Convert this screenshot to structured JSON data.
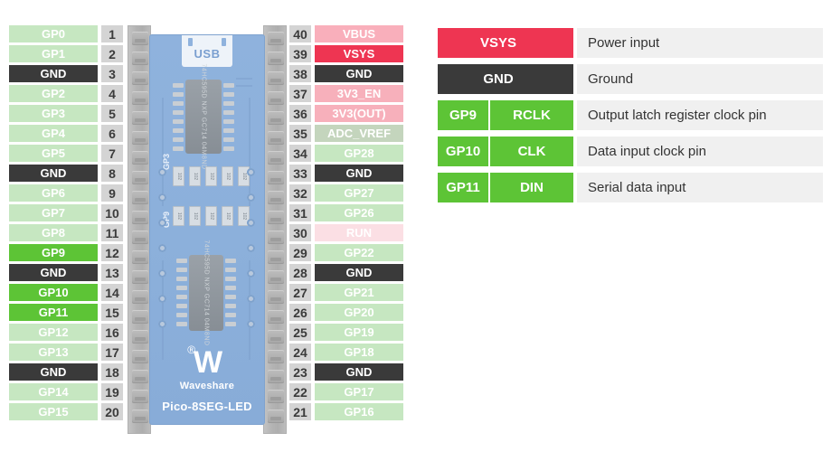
{
  "board": {
    "usb_label": "USB",
    "brand": "Waveshare",
    "brand_mark": "W",
    "registered_mark": "®",
    "model": "Pico-8SEG-LED",
    "silk_labels": [
      "GP3",
      "GP9"
    ],
    "ic_top_text": "74HC595D NXP GC714 04M8ND",
    "ic_bottom_text": "74HC595D NXP GC714 04M8ND"
  },
  "left_column": [
    {
      "num": "1",
      "label": "GP0",
      "type": "gpio"
    },
    {
      "num": "2",
      "label": "GP1",
      "type": "gpio"
    },
    {
      "num": "3",
      "label": "GND",
      "type": "gnd"
    },
    {
      "num": "4",
      "label": "GP2",
      "type": "gpio"
    },
    {
      "num": "5",
      "label": "GP3",
      "type": "gpio"
    },
    {
      "num": "6",
      "label": "GP4",
      "type": "gpio"
    },
    {
      "num": "7",
      "label": "GP5",
      "type": "gpio"
    },
    {
      "num": "8",
      "label": "GND",
      "type": "gnd"
    },
    {
      "num": "9",
      "label": "GP6",
      "type": "gpio"
    },
    {
      "num": "10",
      "label": "GP7",
      "type": "gpio"
    },
    {
      "num": "11",
      "label": "GP8",
      "type": "gpio"
    },
    {
      "num": "12",
      "label": "GP9",
      "type": "gpio-highlight"
    },
    {
      "num": "13",
      "label": "GND",
      "type": "gnd"
    },
    {
      "num": "14",
      "label": "GP10",
      "type": "gpio-highlight"
    },
    {
      "num": "15",
      "label": "GP11",
      "type": "gpio-highlight"
    },
    {
      "num": "16",
      "label": "GP12",
      "type": "gpio"
    },
    {
      "num": "17",
      "label": "GP13",
      "type": "gpio"
    },
    {
      "num": "18",
      "label": "GND",
      "type": "gnd"
    },
    {
      "num": "19",
      "label": "GP14",
      "type": "gpio"
    },
    {
      "num": "20",
      "label": "GP15",
      "type": "gpio"
    }
  ],
  "right_column": [
    {
      "num": "40",
      "label": "VBUS",
      "type": "vbus"
    },
    {
      "num": "39",
      "label": "VSYS",
      "type": "vsys"
    },
    {
      "num": "38",
      "label": "GND",
      "type": "gnd"
    },
    {
      "num": "37",
      "label": "3V3_EN",
      "type": "power3v3"
    },
    {
      "num": "36",
      "label": "3V3(OUT)",
      "type": "power3v3"
    },
    {
      "num": "35",
      "label": "ADC_VREF",
      "type": "adc"
    },
    {
      "num": "34",
      "label": "GP28",
      "type": "gpio"
    },
    {
      "num": "33",
      "label": "GND",
      "type": "gnd"
    },
    {
      "num": "32",
      "label": "GP27",
      "type": "gpio"
    },
    {
      "num": "31",
      "label": "GP26",
      "type": "gpio"
    },
    {
      "num": "30",
      "label": "RUN",
      "type": "run"
    },
    {
      "num": "29",
      "label": "GP22",
      "type": "gpio"
    },
    {
      "num": "28",
      "label": "GND",
      "type": "gnd"
    },
    {
      "num": "27",
      "label": "GP21",
      "type": "gpio"
    },
    {
      "num": "26",
      "label": "GP20",
      "type": "gpio"
    },
    {
      "num": "25",
      "label": "GP19",
      "type": "gpio"
    },
    {
      "num": "24",
      "label": "GP18",
      "type": "gpio"
    },
    {
      "num": "23",
      "label": "GND",
      "type": "gnd"
    },
    {
      "num": "22",
      "label": "GP17",
      "type": "gpio"
    },
    {
      "num": "21",
      "label": "GP16",
      "type": "gpio"
    }
  ],
  "legend": [
    {
      "gp": "",
      "name": "VSYS",
      "desc": "Power input",
      "type": "vsys"
    },
    {
      "gp": "",
      "name": "GND",
      "desc": "Ground",
      "type": "gnd"
    },
    {
      "gp": "GP9",
      "name": "RCLK",
      "desc": "Output latch register clock pin",
      "type": "gpio-highlight"
    },
    {
      "gp": "GP10",
      "name": "CLK",
      "desc": "Data input clock pin",
      "type": "gpio-highlight"
    },
    {
      "gp": "GP11",
      "name": "DIN",
      "desc": "Serial data input",
      "type": "gpio-highlight"
    }
  ],
  "colors": {
    "gpio": "#c6e7c1",
    "gpio_highlight": "#5dc436",
    "gnd": "#3a3a3a",
    "vbus": "#f9afbb",
    "vsys": "#ee3552",
    "power3v3": "#f7b0bb",
    "run": "#fbdfe4",
    "adc": "#c4d5bd",
    "pin_number_bg": "#d4d4d4",
    "legend_desc_bg": "#f0f0f0",
    "pcb": "#8cb0db"
  }
}
